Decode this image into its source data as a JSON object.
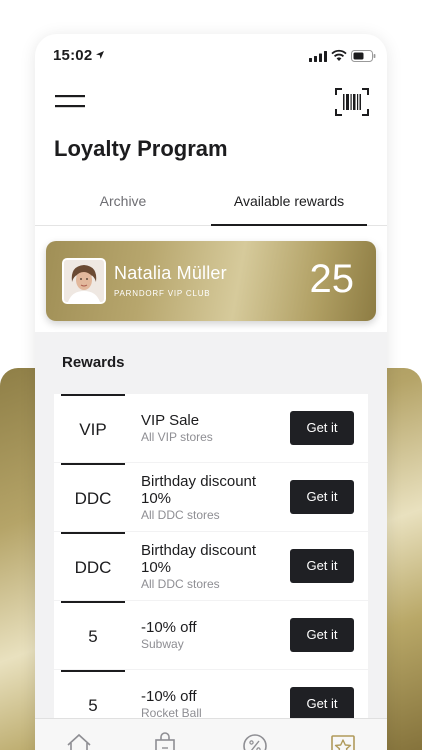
{
  "status_bar": {
    "time": "15:02"
  },
  "header": {
    "title": "Loyalty Program"
  },
  "tabs": [
    {
      "label": "Archive",
      "active": false
    },
    {
      "label": "Available rewards",
      "active": true
    }
  ],
  "member_card": {
    "name": "Natalia Müller",
    "club": "PARNDORF VIP CLUB",
    "points": "25"
  },
  "rewards": {
    "heading": "Rewards",
    "items": [
      {
        "code": "VIP",
        "title": "VIP Sale",
        "subtitle": "All VIP stores",
        "button": "Get it"
      },
      {
        "code": "DDC",
        "title": "Birthday discount 10%",
        "subtitle": "All DDC stores",
        "button": "Get it"
      },
      {
        "code": "DDC",
        "title": "Birthday discount 10%",
        "subtitle": "All DDC stores",
        "button": "Get it"
      },
      {
        "code": "5",
        "title": "-10% off",
        "subtitle": "Subway",
        "button": "Get it"
      },
      {
        "code": "5",
        "title": "-10% off",
        "subtitle": "Rocket Ball",
        "button": "Get it"
      }
    ]
  },
  "tab_bar": {
    "items": [
      {
        "icon": "home-icon",
        "active": false
      },
      {
        "icon": "shopping-bag-icon",
        "active": false
      },
      {
        "icon": "discount-icon",
        "active": false
      },
      {
        "icon": "star-icon",
        "active": true
      }
    ]
  },
  "colors": {
    "gold": "#b5a468",
    "button_dark": "#1f2024",
    "active_tab_icon": "#b09a5a"
  }
}
